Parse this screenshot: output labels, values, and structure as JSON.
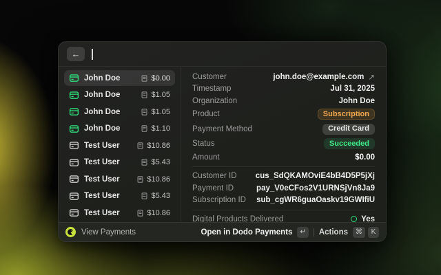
{
  "header": {
    "back_icon": "←"
  },
  "list": {
    "items": [
      {
        "name": "John Doe",
        "amount": "$0.00",
        "icon": "credit-card",
        "variant": "green",
        "selected": true
      },
      {
        "name": "John Doe",
        "amount": "$1.05",
        "icon": "credit-card",
        "variant": "green",
        "selected": false
      },
      {
        "name": "John Doe",
        "amount": "$1.05",
        "icon": "credit-card",
        "variant": "green",
        "selected": false
      },
      {
        "name": "John Doe",
        "amount": "$1.10",
        "icon": "credit-card",
        "variant": "green",
        "selected": false
      },
      {
        "name": "Test User",
        "amount": "$10.86",
        "icon": "credit-card",
        "variant": "gray",
        "selected": false
      },
      {
        "name": "Test User",
        "amount": "$5.43",
        "icon": "credit-card",
        "variant": "gray",
        "selected": false
      },
      {
        "name": "Test User",
        "amount": "$10.86",
        "icon": "credit-card",
        "variant": "gray",
        "selected": false
      },
      {
        "name": "Test User",
        "amount": "$5.43",
        "icon": "credit-card",
        "variant": "gray",
        "selected": false
      },
      {
        "name": "Test User",
        "amount": "$10.86",
        "icon": "credit-card",
        "variant": "gray",
        "selected": false
      }
    ]
  },
  "details": {
    "sections": [
      {
        "rows": [
          {
            "label": "Customer",
            "value": "john.doe@example.com",
            "type": "link",
            "link_icon": "↗"
          },
          {
            "label": "Timestamp",
            "value": "Jul 31, 2025",
            "type": "text"
          },
          {
            "label": "Organization",
            "value": "John Doe",
            "type": "text"
          },
          {
            "label": "Product",
            "value": "Subscription",
            "type": "badge",
            "badge": "orange"
          },
          {
            "label": "Payment Method",
            "value": "Credit Card",
            "type": "badge",
            "badge": "gray"
          },
          {
            "label": "Status",
            "value": "Succeeded",
            "type": "badge",
            "badge": "green"
          },
          {
            "label": "Amount",
            "value": "$0.00",
            "type": "strong"
          }
        ]
      },
      {
        "rows": [
          {
            "label": "Customer ID",
            "value": "cus_SdQKAMOviE4bB4D5P5jXj",
            "type": "text"
          },
          {
            "label": "Payment ID",
            "value": "pay_V0eCFos2V1URNSjVn8Ja9",
            "type": "text"
          },
          {
            "label": "Subscription ID",
            "value": "sub_cgWR6guaOaskv19GWIfiU",
            "type": "text"
          }
        ]
      },
      {
        "rows": [
          {
            "label": "Digital Products Delivered",
            "value": "Yes",
            "type": "indicator"
          }
        ]
      }
    ]
  },
  "footer": {
    "app_name": "View Payments",
    "primary_action": "Open in Dodo Payments",
    "primary_key": "↵",
    "divider": "|",
    "actions_label": "Actions",
    "action_keys": [
      "⌘",
      "K"
    ]
  },
  "colors": {
    "accent_green": "#2ee27c",
    "badge_orange": "#f2a64d",
    "badge_green": "#3ee686",
    "logo_yellow": "#c9e23c"
  }
}
